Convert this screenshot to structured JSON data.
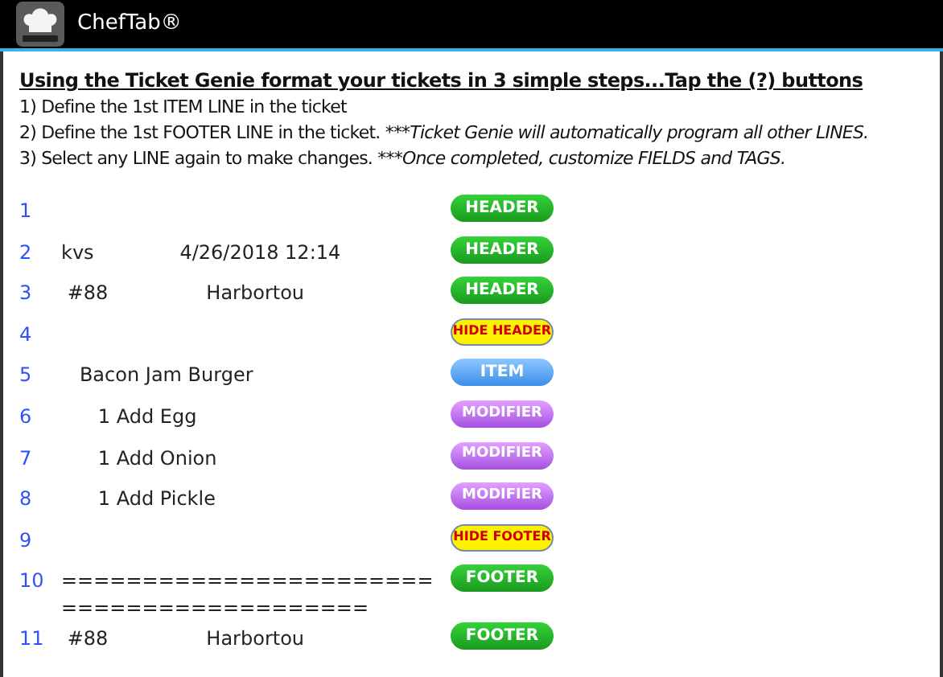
{
  "app_bar": {
    "title": "ChefTab®"
  },
  "instructions": {
    "heading": "Using the Ticket Genie format your tickets in 3 simple steps...Tap the (?) buttons",
    "steps": [
      {
        "text": "1) Define the 1st ITEM LINE in the ticket"
      },
      {
        "text": "2) Define the 1st FOOTER LINE in the ticket.",
        "note": "***Ticket Genie will automatically program all other LINES."
      },
      {
        "text": "3) Select any LINE again to make changes.",
        "note": "***Once completed, customize FIELDS and TAGS."
      }
    ]
  },
  "lines": [
    {
      "number": "1",
      "button": {
        "label": "HEADER",
        "kind": "header"
      }
    },
    {
      "number": "2",
      "text": "kvs              4/26/2018 12:14",
      "button": {
        "label": "HEADER",
        "kind": "header"
      }
    },
    {
      "number": "3",
      "text": " #88                Harbortou",
      "button": {
        "label": "HEADER",
        "kind": "header"
      }
    },
    {
      "number": "4",
      "button": {
        "label": "HIDE HEADER",
        "kind": "hide"
      }
    },
    {
      "number": "5",
      "text": "   Bacon Jam Burger",
      "button": {
        "label": "ITEM",
        "kind": "item"
      }
    },
    {
      "number": "6",
      "text": "      1 Add Egg",
      "button": {
        "label": "MODIFIER",
        "kind": "modifier"
      }
    },
    {
      "number": "7",
      "text": "      1 Add Onion",
      "button": {
        "label": "MODIFIER",
        "kind": "modifier"
      }
    },
    {
      "number": "8",
      "text": "      1 Add Pickle",
      "button": {
        "label": "MODIFIER",
        "kind": "modifier"
      }
    },
    {
      "number": "9",
      "button": {
        "label": "HIDE FOOTER",
        "kind": "hide"
      }
    },
    {
      "number": "10",
      "text": "==========================================",
      "button": {
        "label": "FOOTER",
        "kind": "footer"
      }
    },
    {
      "number": "11",
      "text": " #88                Harbortou",
      "button": {
        "label": "FOOTER",
        "kind": "footer"
      }
    }
  ]
}
